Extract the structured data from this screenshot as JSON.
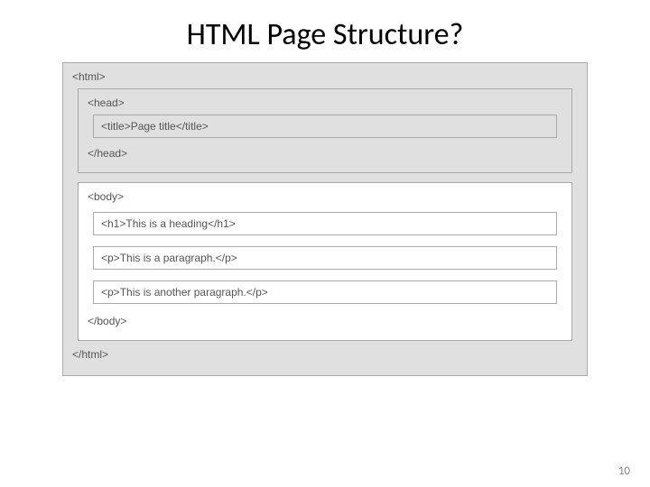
{
  "title": "HTML Page Structure?",
  "diagram": {
    "html_open": "<html>",
    "html_close": "</html>",
    "head": {
      "open": "<head>",
      "close": "</head>",
      "title_line": "<title>Page title</title>"
    },
    "body": {
      "open": "<body>",
      "close": "</body>",
      "elements": [
        "<h1>This is a heading</h1>",
        "<p>This is a paragraph.</p>",
        "<p>This is another paragraph.</p>"
      ]
    }
  },
  "page_number": "10"
}
